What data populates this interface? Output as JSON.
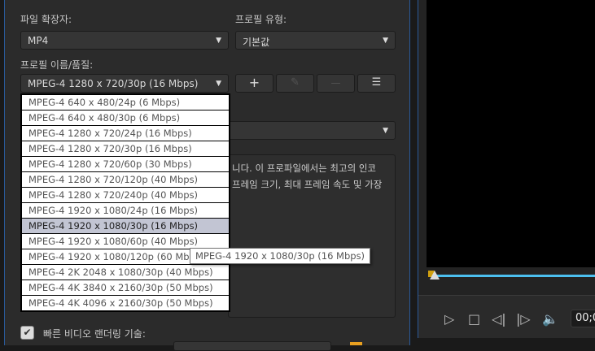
{
  "labels": {
    "file_ext": "파일 확장자:",
    "profile_type": "프로필 유형:",
    "profile_name": "프로필 이름/품질:",
    "fast_render": "빠른 비디오 랜더링 기술:"
  },
  "file_ext_value": "MP4",
  "profile_type_value": "기본값",
  "profile_name_value": "MPEG-4 1280 x 720/30p (16 Mbps)",
  "buttons": {
    "add": "+",
    "edit": "✎",
    "remove": "—",
    "details": "☰"
  },
  "description": [
    "니다. 이 프로파일에서는 최고의 인코",
    "프레임 크기, 최대 프레임 속도 및 가장"
  ],
  "options": [
    "MPEG-4 640 x 480/24p (6 Mbps)",
    "MPEG-4 640 x 480/30p (6 Mbps)",
    "MPEG-4 1280 x 720/24p (16 Mbps)",
    "MPEG-4 1280 x 720/30p (16 Mbps)",
    "MPEG-4 1280 x 720/60p (30 Mbps)",
    "MPEG-4 1280 x 720/120p (40 Mbps)",
    "MPEG-4 1280 x 720/240p (40 Mbps)",
    "MPEG-4 1920 x 1080/24p (16 Mbps)",
    "MPEG-4 1920 x 1080/30p (16 Mbps)",
    "MPEG-4 1920 x 1080/60p (40 Mbps)",
    "MPEG-4 1920 x 1080/120p (60 Mbps)",
    "MPEG-4 2K 2048 x 1080/30p (40 Mbps)",
    "MPEG-4 4K 3840 x 2160/30p (50 Mbps)",
    "MPEG-4 4K 4096 x 2160/30p (50 Mbps)"
  ],
  "highlighted_index": 8,
  "tooltip": "MPEG-4 1920 x 1080/30p (16 Mbps)",
  "player": {
    "time": "00;0"
  }
}
